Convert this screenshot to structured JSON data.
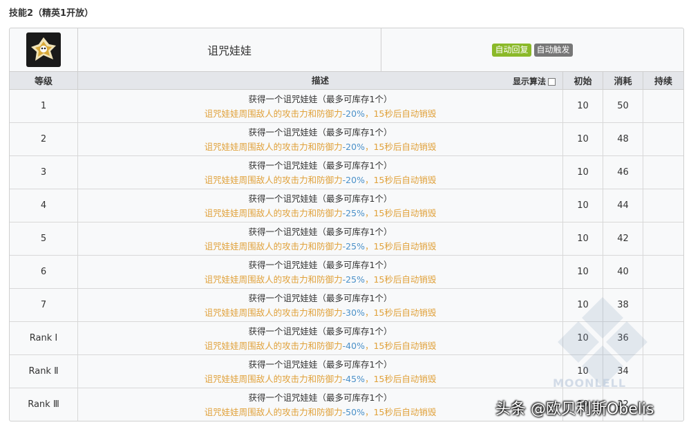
{
  "heading": "技能2（精英1开放）",
  "skill": {
    "name": "诅咒娃娃",
    "tags": [
      "自动回复",
      "自动触发"
    ],
    "icon": "skill-doll-icon"
  },
  "columns": {
    "level": "等级",
    "description": "描述",
    "algorithm": "显示算法",
    "initial": "初始",
    "cost": "消耗",
    "duration": "持续"
  },
  "rows": [
    {
      "level": "1",
      "line1": "获得一个诅咒娃娃（最多可库存1个）",
      "pre": "诅咒娃娃周围敌人的攻击力和防御力",
      "val": "-20%",
      "post": "，15秒后自动销毁",
      "init": "10",
      "cost": "50",
      "duration": ""
    },
    {
      "level": "2",
      "line1": "获得一个诅咒娃娃（最多可库存1个）",
      "pre": "诅咒娃娃周围敌人的攻击力和防御力",
      "val": "-20%",
      "post": "，15秒后自动销毁",
      "init": "10",
      "cost": "48",
      "duration": ""
    },
    {
      "level": "3",
      "line1": "获得一个诅咒娃娃（最多可库存1个）",
      "pre": "诅咒娃娃周围敌人的攻击力和防御力",
      "val": "-20%",
      "post": "，15秒后自动销毁",
      "init": "10",
      "cost": "46",
      "duration": ""
    },
    {
      "level": "4",
      "line1": "获得一个诅咒娃娃（最多可库存1个）",
      "pre": "诅咒娃娃周围敌人的攻击力和防御力",
      "val": "-25%",
      "post": "，15秒后自动销毁",
      "init": "10",
      "cost": "44",
      "duration": ""
    },
    {
      "level": "5",
      "line1": "获得一个诅咒娃娃（最多可库存1个）",
      "pre": "诅咒娃娃周围敌人的攻击力和防御力",
      "val": "-25%",
      "post": "，15秒后自动销毁",
      "init": "10",
      "cost": "42",
      "duration": ""
    },
    {
      "level": "6",
      "line1": "获得一个诅咒娃娃（最多可库存1个）",
      "pre": "诅咒娃娃周围敌人的攻击力和防御力",
      "val": "-25%",
      "post": "，15秒后自动销毁",
      "init": "10",
      "cost": "40",
      "duration": ""
    },
    {
      "level": "7",
      "line1": "获得一个诅咒娃娃（最多可库存1个）",
      "pre": "诅咒娃娃周围敌人的攻击力和防御力",
      "val": "-30%",
      "post": "，15秒后自动销毁",
      "init": "10",
      "cost": "38",
      "duration": ""
    },
    {
      "level": "Rank Ⅰ",
      "line1": "获得一个诅咒娃娃（最多可库存1个）",
      "pre": "诅咒娃娃周围敌人的攻击力和防御力",
      "val": "-40%",
      "post": "，15秒后自动销毁",
      "init": "10",
      "cost": "36",
      "duration": ""
    },
    {
      "level": "Rank Ⅱ",
      "line1": "获得一个诅咒娃娃（最多可库存1个）",
      "pre": "诅咒娃娃周围敌人的攻击力和防御力",
      "val": "-45%",
      "post": "，15秒后自动销毁",
      "init": "10",
      "cost": "34",
      "duration": ""
    },
    {
      "level": "Rank Ⅲ",
      "line1": "获得一个诅咒娃娃（最多可库存1个）",
      "pre": "诅咒娃娃周围敌人的攻击力和防御力",
      "val": "-50%",
      "post": "，15秒后自动销毁",
      "init": "10",
      "cost": "32",
      "duration": ""
    }
  ],
  "watermark": "MOONLELL",
  "credit": "头条 @欧贝利斯Obelis",
  "colors": {
    "accent_orange": "#e0a13a",
    "value_blue": "#4a90c8",
    "tag_green": "#8bb929",
    "tag_gray": "#777777"
  }
}
